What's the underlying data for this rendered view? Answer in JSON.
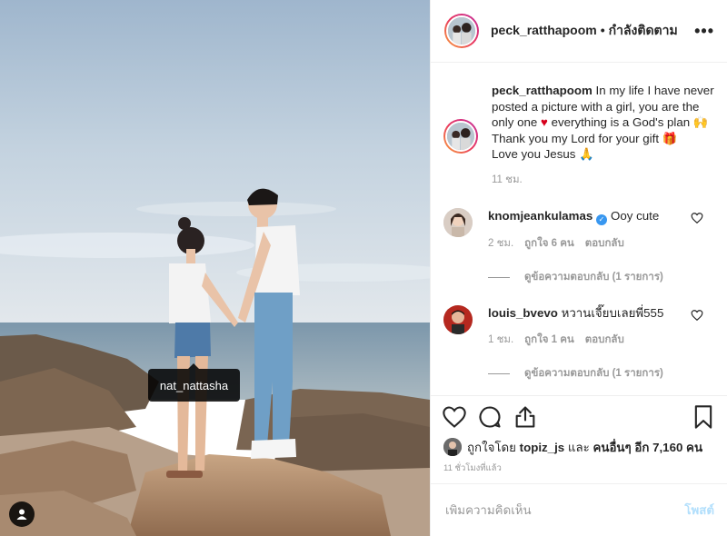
{
  "photo": {
    "tag_label": "nat_nattasha"
  },
  "header": {
    "username": "peck_ratthapoom",
    "separator": "•",
    "follow_status": "กำลังติดตาม",
    "more_label": "•••"
  },
  "caption": {
    "username": "peck_ratthapoom",
    "line1": "In my life I have never posted a picture with a girl, you are the only one",
    "heart": "♥",
    "line1b": "everything is a God's plan",
    "emoji1": "🙌",
    "line2": "Thank you my Lord for your gift",
    "emoji2": "🎁",
    "line3": "Love you Jesus",
    "emoji3": "🙏",
    "time": "11 ชม."
  },
  "comments": [
    {
      "username": "knomjeankulamas",
      "verified": true,
      "verified_mark": "✓",
      "text": "Ooy cute",
      "time": "2 ชม.",
      "likes": "ถูกใจ 6 คน",
      "reply": "ตอบกลับ",
      "replies": "ดูข้อความตอบกลับ (1 รายการ)"
    },
    {
      "username": "louis_bvevo",
      "verified": false,
      "text": "หวานเจี๊ยบเลยพี่555",
      "time": "1 ชม.",
      "likes": "ถูกใจ 1 คน",
      "reply": "ตอบกลับ",
      "replies": "ดูข้อความตอบกลับ (1 รายการ)"
    }
  ],
  "likes": {
    "prefix": "ถูกใจโดย",
    "user": "topiz_js",
    "middle": "และ",
    "others": "คนอื่นๆ อีก 7,160 คน"
  },
  "time_ago": "11 ชั่วโมงที่แล้ว",
  "add_comment": {
    "placeholder": "เพิ่มความคิดเห็น",
    "post_label": "โพสต์"
  },
  "colors": {
    "accent": "#3897f0",
    "post_button": "#b2dffc",
    "heart": "#d6001c"
  }
}
